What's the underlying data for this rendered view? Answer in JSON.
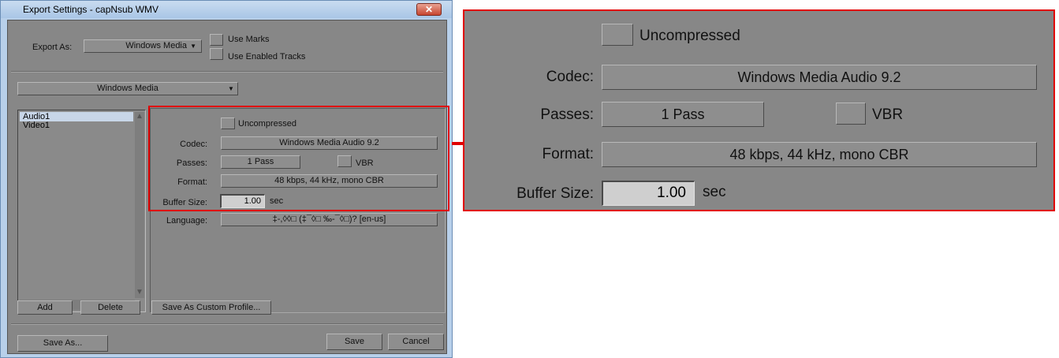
{
  "window": {
    "title": "Export Settings - capNsub WMV",
    "close_glyph": "✕"
  },
  "export": {
    "export_as_label": "Export As:",
    "export_as_value": "Windows Media",
    "use_marks_label": "Use Marks",
    "use_enabled_tracks_label": "Use Enabled Tracks"
  },
  "profile": {
    "value": "Windows Media"
  },
  "tracks": {
    "items": [
      "Audio1",
      "Video1"
    ],
    "selected_index": 0
  },
  "settings": {
    "uncompressed_label": "Uncompressed",
    "codec_label": "Codec:",
    "codec_value": "Windows Media Audio 9.2",
    "passes_label": "Passes:",
    "passes_value": "1 Pass",
    "vbr_label": "VBR",
    "format_label": "Format:",
    "format_value": "48 kbps, 44 kHz, mono CBR",
    "buffer_label": "Buffer Size:",
    "buffer_value": "1.00",
    "buffer_unit": "sec",
    "language_label": "Language:",
    "language_value": "‡-,◊◊□ (‡¯◊□ ‰-¯◊□)? [en-us]"
  },
  "buttons": {
    "add": "Add",
    "delete": "Delete",
    "save_custom_profile": "Save As Custom Profile...",
    "save_as": "Save As...",
    "save": "Save",
    "cancel": "Cancel"
  },
  "colors": {
    "panel_gray": "#878787",
    "highlight_red": "#e00000",
    "title_blue": "#b8d0ea",
    "selection_blue": "#c8d6e8"
  },
  "icons": {
    "dropdown": "▼",
    "scroll_up": "▲",
    "scroll_down": "▼",
    "scroll_left": "◀",
    "scroll_right": "▶",
    "scroll_grip": "|||"
  }
}
